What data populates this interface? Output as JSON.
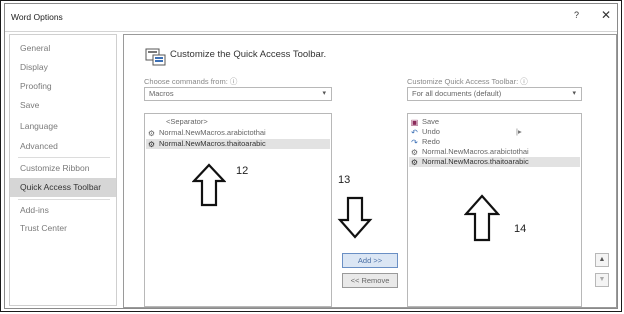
{
  "window": {
    "title": "Word Options",
    "help_label": "?",
    "close_label": "✕"
  },
  "nav": {
    "items": [
      {
        "label": "General"
      },
      {
        "label": "Display"
      },
      {
        "label": "Proofing"
      },
      {
        "label": "Save"
      },
      {
        "label": "Language"
      },
      {
        "label": "Advanced"
      },
      {
        "label": "Customize Ribbon"
      },
      {
        "label": "Quick Access Toolbar",
        "active": true
      },
      {
        "label": "Add-ins"
      },
      {
        "label": "Trust Center"
      }
    ]
  },
  "main": {
    "heading": "Customize the Quick Access Toolbar.",
    "choose_label": "Choose commands from:",
    "choose_info": "ⓘ",
    "choose_value": "Macros",
    "customize_label": "Customize Quick Access Toolbar:",
    "customize_info": "ⓘ",
    "customize_value": "For all documents (default)",
    "left_list": [
      {
        "label": "<Separator>",
        "icon": ""
      },
      {
        "label": "Normal.NewMacros.arabictothai",
        "icon": "macro-icon"
      },
      {
        "label": "Normal.NewMacros.thaitoarabic",
        "icon": "macro-icon",
        "selected": true
      }
    ],
    "right_list": [
      {
        "label": "Save",
        "icon": "save-icon"
      },
      {
        "label": "Undo",
        "icon": "undo-icon"
      },
      {
        "label": "Redo",
        "icon": "redo-icon"
      },
      {
        "label": "Normal.NewMacros.arabictothai",
        "icon": "macro-icon"
      },
      {
        "label": "Normal.NewMacros.thaitoarabic",
        "icon": "macro-icon",
        "selected": true
      }
    ],
    "add_label": "Add >>",
    "remove_label": "<< Remove",
    "move_up_label": "▲",
    "move_down_label": "▼",
    "undo_expander": "|▸"
  },
  "annotations": {
    "left_number": "12",
    "middle_number": "13",
    "right_number": "14"
  }
}
